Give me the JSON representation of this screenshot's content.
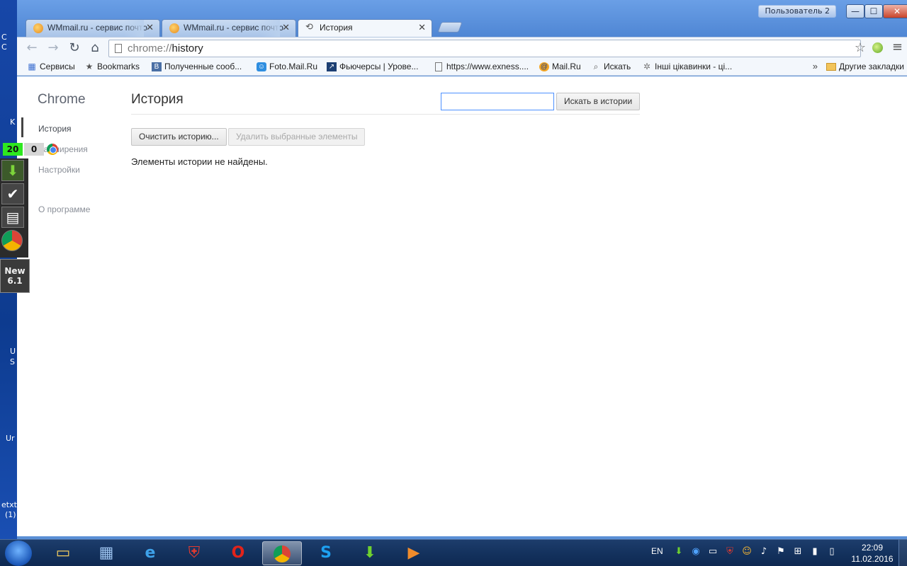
{
  "desktop": {
    "left_labels": [
      "C",
      "C",
      "K",
      "U",
      "S",
      "Ur",
      "etxt",
      "(1)"
    ]
  },
  "window": {
    "user_badge": "Пользователь 2",
    "controls": {
      "minimize": "—",
      "maximize": "☐",
      "close": "✕"
    }
  },
  "tabs": [
    {
      "title": "WMmail.ru - сервис почто",
      "active": false
    },
    {
      "title": "WMmail.ru - сервис почто",
      "active": false
    },
    {
      "title": "История",
      "active": true
    }
  ],
  "toolbar": {
    "back_icon": "arrow-left-icon",
    "forward_icon": "arrow-right-icon",
    "reload_icon": "reload-icon",
    "home_icon": "home-icon",
    "url_scheme": "chrome://",
    "url_path": "history"
  },
  "bookmarks": {
    "items": [
      {
        "label": "Сервисы",
        "icon": "apps-grid-icon"
      },
      {
        "label": "Bookmarks",
        "icon": "star-icon"
      },
      {
        "label": "Полученные сооб...",
        "icon": "vk-icon"
      },
      {
        "label": "Foto.Mail.Ru",
        "icon": "smile-icon"
      },
      {
        "label": "Фьючерсы | Урове...",
        "icon": "chart-icon"
      },
      {
        "label": "https://www.exness....",
        "icon": "page-icon"
      },
      {
        "label": "Mail.Ru",
        "icon": "mailru-icon"
      },
      {
        "label": "Искать",
        "icon": "search-icon"
      },
      {
        "label": "Інші цікавинки - ці...",
        "icon": "star-outline-icon"
      }
    ],
    "overflow": "»",
    "other": "Другие закладки"
  },
  "sidebar": {
    "title": "Chrome",
    "items": [
      {
        "label": "История",
        "selected": true
      },
      {
        "label": "Расширения",
        "selected": false
      },
      {
        "label": "Настройки",
        "selected": false
      },
      {
        "label": "О программе",
        "selected": false
      }
    ]
  },
  "history": {
    "title": "История",
    "search_value": "",
    "search_button": "Искать в истории",
    "clear_button": "Очистить историю...",
    "remove_button": "Удалить выбранные элементы",
    "empty_message": "Элементы истории не найдены."
  },
  "overlay_widget": {
    "counter_green": "20",
    "counter_gray": "0",
    "new_label_line1": "New",
    "new_label_line2": "6.1"
  },
  "taskbar": {
    "apps": [
      "explorer",
      "control-panel",
      "internet-explorer",
      "shield",
      "opera",
      "chrome",
      "skype",
      "download",
      "media-player"
    ],
    "language": "EN",
    "time": "22:09",
    "date": "11.02.2016"
  }
}
